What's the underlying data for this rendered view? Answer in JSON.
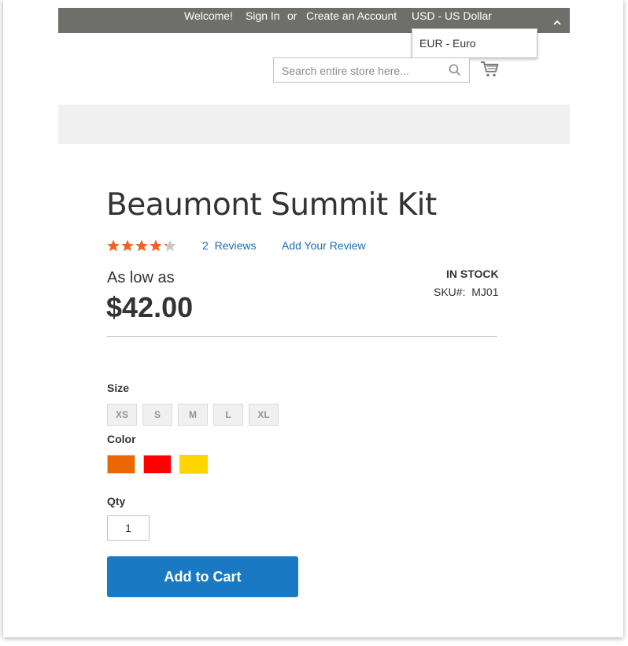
{
  "header": {
    "welcome": "Welcome!",
    "sign_in": "Sign In",
    "or": "or",
    "create_account": "Create an Account",
    "currency_current": "USD - US Dollar",
    "currency_options": [
      "EUR - Euro"
    ]
  },
  "search": {
    "placeholder": "Search entire store here..."
  },
  "product": {
    "name": "Beaumont Summit Kit",
    "rating_fraction": 0.86,
    "reviews_count": "2",
    "reviews_label": "Reviews",
    "add_review": "Add Your Review",
    "price_prefix": "As low as",
    "price": "$42.00",
    "stock": "IN STOCK",
    "sku_label": "SKU#:",
    "sku": "MJ01"
  },
  "options": {
    "size_label": "Size",
    "sizes": [
      "XS",
      "S",
      "M",
      "L",
      "XL"
    ],
    "color_label": "Color",
    "colors": [
      "#eb6703",
      "#ff0000",
      "#ffd500"
    ],
    "qty_label": "Qty",
    "qty_value": "1"
  },
  "actions": {
    "add_to_cart": "Add to Cart"
  },
  "theme": {
    "topbar_bg": "#6e6e6a",
    "link_color": "#1a6eb5",
    "star_color": "#f26322",
    "button_bg": "#1979c3"
  }
}
